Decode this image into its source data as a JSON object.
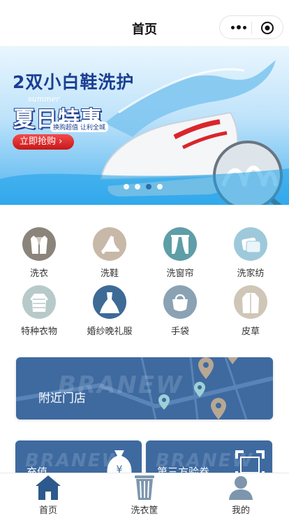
{
  "nav": {
    "title": "首页"
  },
  "banner": {
    "headline": "2双小白鞋洗护",
    "summer": "summer",
    "promo": "夏日特惠",
    "sub": "换购超值 让利全城",
    "cta": "立即抢购 ›",
    "slides": 4,
    "active_slide": 3
  },
  "categories": [
    {
      "label": "洗衣",
      "icon": "suit-icon",
      "color": "#8a847b"
    },
    {
      "label": "洗鞋",
      "icon": "high-heel-icon",
      "color": "#c8b8a8"
    },
    {
      "label": "洗窗帘",
      "icon": "curtain-icon",
      "color": "#5e9ea7"
    },
    {
      "label": "洗家纺",
      "icon": "pillow-icon",
      "color": "#9ec9da"
    },
    {
      "label": "特种衣物",
      "icon": "down-jacket-icon",
      "color": "#b8c9c9"
    },
    {
      "label": "婚纱晚礼服",
      "icon": "wedding-dress-icon",
      "color": "#3e6a96"
    },
    {
      "label": "手袋",
      "icon": "handbag-icon",
      "color": "#8aa2b3"
    },
    {
      "label": "皮草",
      "icon": "fur-coat-icon",
      "color": "#cfc6b7"
    }
  ],
  "store_card": {
    "label": "附近门店",
    "watermark": "BRANEW"
  },
  "service_cards": [
    {
      "label": "充值",
      "watermark": "BRANEW"
    },
    {
      "label": "第三方验卷",
      "watermark": "BRANEW"
    }
  ],
  "tabbar": [
    {
      "label": "首页",
      "icon": "home-icon"
    },
    {
      "label": "洗衣筐",
      "icon": "laundry-basket-icon"
    },
    {
      "label": "我的",
      "icon": "user-icon"
    }
  ],
  "colors": {
    "accent": "#2c5a8c",
    "tab_icon": "#2c5a8c"
  }
}
